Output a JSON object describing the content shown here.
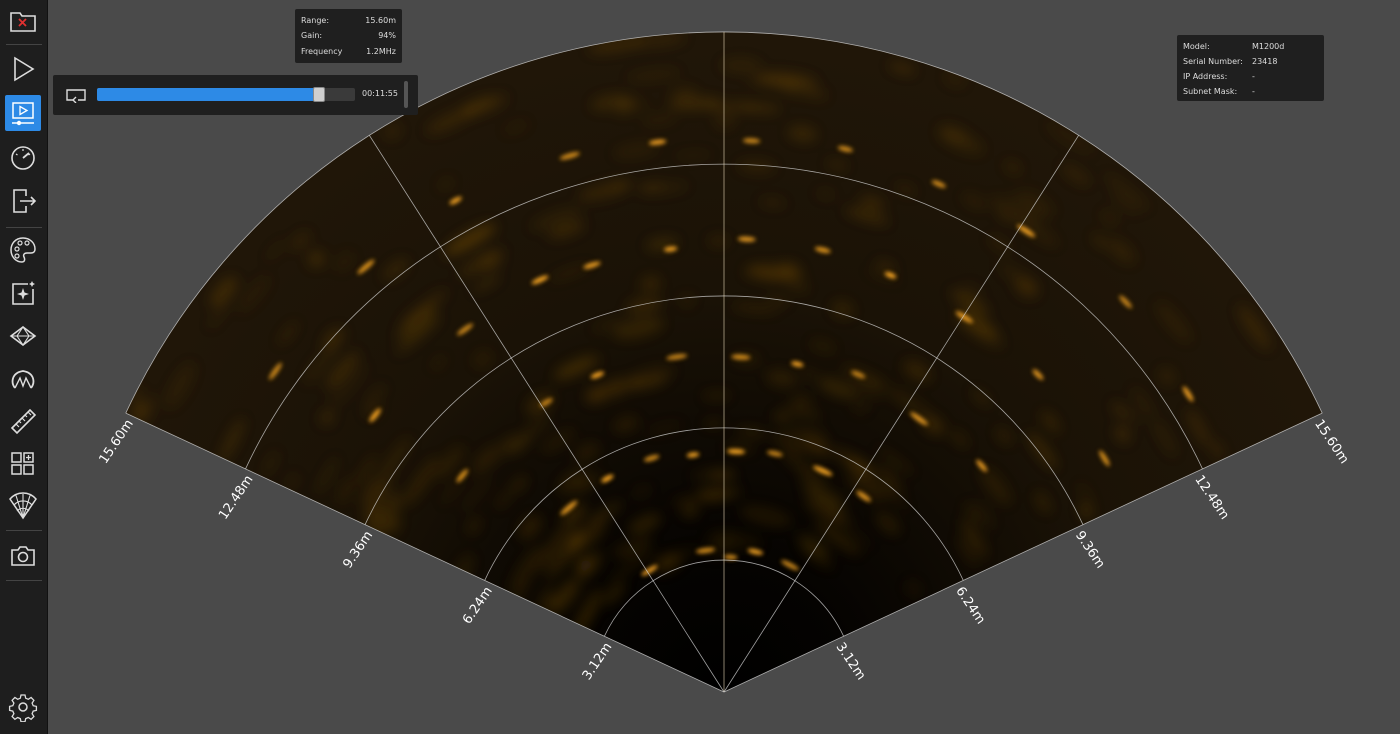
{
  "stats": {
    "range_label": "Range:",
    "range_value": "15.60m",
    "gain_label": "Gain:",
    "gain_value": "94%",
    "frequency_label": "Frequency",
    "frequency_value": "1.2MHz"
  },
  "device": {
    "model_label": "Model:",
    "model_value": "M1200d",
    "serial_label": "Serial Number:",
    "serial_value": "23418",
    "ip_label": "IP Address:",
    "ip_value": "-",
    "subnet_label": "Subnet Mask:",
    "subnet_value": "-"
  },
  "playback": {
    "time": "00:11:55",
    "progress": 0.86
  },
  "range_labels": {
    "left": [
      "3.12m",
      "6.24m",
      "9.36m",
      "12.48m",
      "15.60m"
    ],
    "right": [
      "3.12m",
      "6.24m",
      "9.36m",
      "12.48m",
      "15.60m"
    ]
  },
  "sidebar_icons": [
    "close-file-icon",
    "play-icon",
    "playback-icon",
    "gauge-icon",
    "export-icon",
    "palette-icon",
    "enhance-icon",
    "gem-icon",
    "horseshoe-icon",
    "ruler-icon",
    "layout-add-icon",
    "sonar-fan-icon",
    "camera-icon",
    "settings-icon"
  ],
  "colors": {
    "accent": "#2d8ae6",
    "sonar_return": "#ffaa22",
    "close_mark": "#e03030"
  }
}
